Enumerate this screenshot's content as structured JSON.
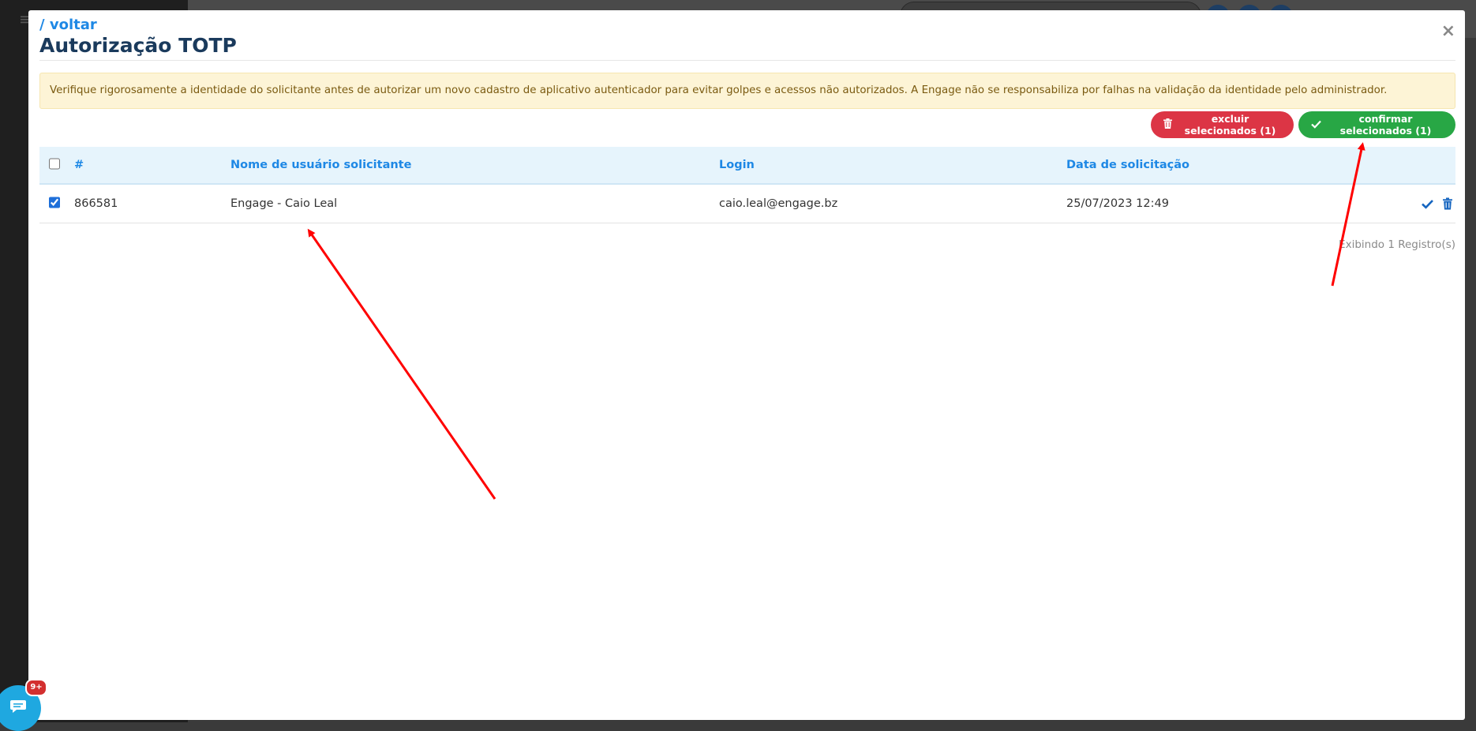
{
  "modal": {
    "back_link": "/ voltar",
    "title": "Autorização TOTP",
    "close_label": "×",
    "alert_text": "Verifique rigorosamente a identidade do solicitante antes de autorizar um novo cadastro de aplicativo autenticador para evitar golpes e acessos não autorizados. A Engage não se responsabiliza por falhas na validação da identidade pelo administrador."
  },
  "actions": {
    "delete_selected_label": "excluir selecionados (1)",
    "confirm_selected_label": "confirmar selecionados (1)",
    "delete_color": "#dc3545",
    "confirm_color": "#28a745"
  },
  "table": {
    "headers": {
      "id": "#",
      "name": "Nome de usuário solicitante",
      "login": "Login",
      "date": "Data de solicitação"
    },
    "rows": [
      {
        "checked": true,
        "id": "866581",
        "name": "Engage - Caio Leal",
        "login": "caio.leal@engage.bz",
        "date": "25/07/2023 12:49"
      }
    ],
    "footer_count": "Exibindo 1 Registro(s)"
  },
  "chat_widget": {
    "badge": "9+"
  },
  "colors": {
    "accent": "#1e88e5",
    "title": "#1a3a5c",
    "annotation_arrow": "#ff0000"
  }
}
